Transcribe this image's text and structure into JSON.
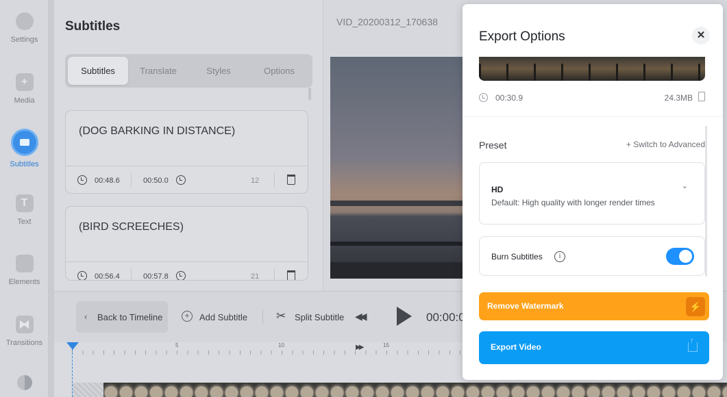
{
  "sidebar": {
    "items": [
      {
        "label": "Settings"
      },
      {
        "label": "Media"
      },
      {
        "label": "Subtitles"
      },
      {
        "label": "Text"
      },
      {
        "label": "Elements"
      },
      {
        "label": "Transitions"
      }
    ]
  },
  "panel": {
    "title": "Subtitles",
    "tabs": [
      "Subtitles",
      "Translate",
      "Styles",
      "Options"
    ],
    "subtitles": [
      {
        "text": "(DOG BARKING IN DISTANCE)",
        "start": "00:48.6",
        "end": "00:50.0",
        "count": "12"
      },
      {
        "text": "(BIRD SCREECHES)",
        "start": "00:56.4",
        "end": "00:57.8",
        "count": "21"
      }
    ]
  },
  "video": {
    "filename": "VID_20200312_170638"
  },
  "toolbar": {
    "back_label": "Back to Timeline",
    "add_label": "Add Subtitle",
    "split_label": "Split Subtitle",
    "timecode": "00:00:0"
  },
  "timeline": {
    "tick_labels": [
      "5",
      "10",
      "15"
    ]
  },
  "export_modal": {
    "title": "Export Options",
    "duration": "00:30.9",
    "file_size": "24.3MB",
    "preset_label": "Preset",
    "switch_advanced": "+ Switch to Advanced",
    "preset_name": "HD",
    "preset_desc": "Default: High quality with longer render times",
    "burn_label": "Burn Subtitles",
    "burn_enabled": true,
    "watermark_label": "Remove Watermark",
    "export_label": "Export Video"
  },
  "colors": {
    "accent": "#1e90ff",
    "watermark": "#ffa21a",
    "export": "#0b9cf5"
  }
}
